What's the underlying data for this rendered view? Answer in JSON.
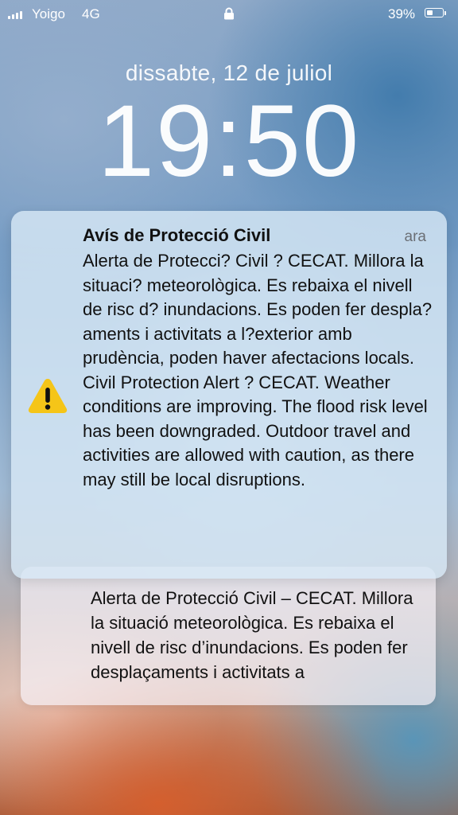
{
  "status_bar": {
    "carrier": "Yoigo",
    "network": "4G",
    "battery_percent": "39%",
    "battery_level": 0.39,
    "lock_icon": "lock-icon"
  },
  "lock_screen": {
    "date": "dissabte, 12 de juliol",
    "time": "19:50"
  },
  "notification": {
    "icon": "warning-icon",
    "title": "Avís de Protecció Civil",
    "time": "ara",
    "body": "Alerta de Protecci? Civil ? CECAT. Millora la situaci? meteorològica. Es rebaixa el nivell de risc d? inundacions. Es poden fer despla? aments i activitats a l?exterior amb prudència, poden haver afectacions locals. Civil Protection Alert ? CECAT. Weather conditions are improving. The flood risk level has been downgraded. Outdoor travel and activities are allowed with caution, as there may still be local disruptions."
  },
  "stacked_notification": {
    "body": "Alerta de Protecció Civil – CECAT. Millora la situació meteorològica. Es rebaixa el nivell de risc d’inundacions. Es poden fer desplaçaments i activitats a"
  }
}
